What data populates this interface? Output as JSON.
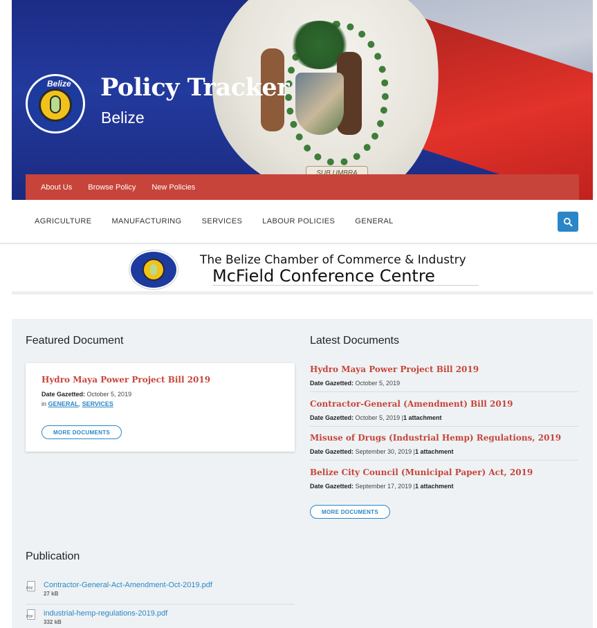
{
  "hero": {
    "title": "Policy Tracker",
    "subtitle": "Belize",
    "logo_text": "Belize",
    "motto": "SUB UMBRA FLOREO"
  },
  "topnav": {
    "items": [
      {
        "label": "About Us"
      },
      {
        "label": "Browse Policy"
      },
      {
        "label": "New Policies"
      }
    ]
  },
  "categories": {
    "items": [
      {
        "label": "AGRICULTURE"
      },
      {
        "label": "MANUFACTURING"
      },
      {
        "label": "SERVICES"
      },
      {
        "label": "LABOUR POLICIES"
      },
      {
        "label": "GENERAL"
      }
    ],
    "search_icon": "search-icon"
  },
  "banner": {
    "line1": "The Belize Chamber of Commerce & Industry",
    "line2": "McField Conference Centre"
  },
  "featured": {
    "heading": "Featured Document",
    "title": "Hydro Maya Power Project Bill 2019",
    "date_label": "Date Gazetted:",
    "date": "October 5, 2019",
    "in_label": "in",
    "categories": [
      "GENERAL",
      "SERVICES"
    ],
    "button": "MORE DOCUMENTS"
  },
  "latest": {
    "heading": "Latest Documents",
    "items": [
      {
        "title": "Hydro Maya Power Project Bill 2019",
        "date_label": "Date Gazetted:",
        "date": "October 5, 2019",
        "attachment": ""
      },
      {
        "title": "Contractor-General (Amendment) Bill 2019",
        "date_label": "Date Gazetted:",
        "date": "October 5, 2019",
        "attachment": "1 attachment"
      },
      {
        "title": "Misuse of Drugs (Industrial Hemp) Regulations, 2019",
        "date_label": "Date Gazetted:",
        "date": "September 30, 2019",
        "attachment": "1 attachment"
      },
      {
        "title": "Belize City Council (Municipal Paper) Act, 2019",
        "date_label": "Date Gazetted:",
        "date": "September 17, 2019",
        "attachment": "1 attachment"
      }
    ],
    "button": "MORE DOCUMENTS"
  },
  "publication": {
    "heading": "Publication",
    "files": [
      {
        "name": "Contractor-General-Act-Amendment-Oct-2019.pdf",
        "size": "27 kB",
        "icon": "pdf-file-icon"
      },
      {
        "name": "industrial-hemp-regulations-2019.pdf",
        "size": "332 kB",
        "icon": "pdf-file-icon"
      }
    ]
  },
  "colors": {
    "nav_red": "#c7443a",
    "link_blue": "#2a86c6",
    "hero_blue": "#1c2c86",
    "content_bg": "#eef2f4"
  }
}
